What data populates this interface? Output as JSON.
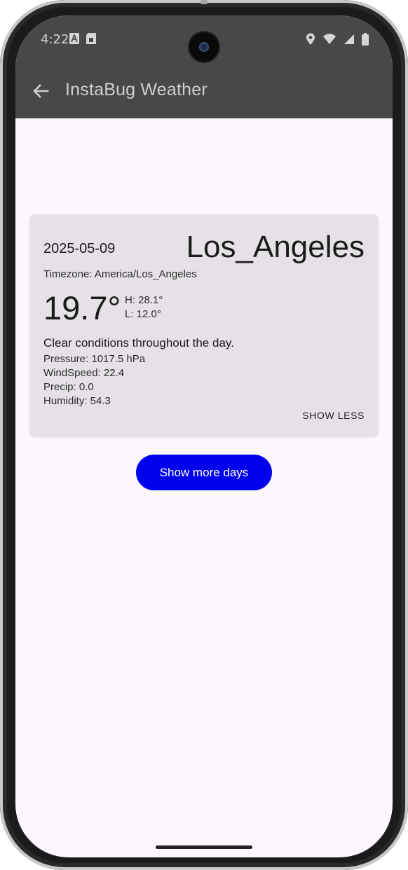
{
  "status_bar": {
    "time": "4:22",
    "icons_left": [
      "a-icon",
      "sim-card-icon"
    ],
    "icons_right": [
      "location-icon",
      "wifi-icon",
      "cellular-signal-icon",
      "battery-icon"
    ]
  },
  "app_bar": {
    "title": "InstaBug Weather",
    "back_icon": "arrow-back-icon"
  },
  "weather_card": {
    "date": "2025-05-09",
    "city": "Los_Angeles",
    "timezone": "Timezone: America/Los_Angeles",
    "temperature": "19.7°",
    "high": "H: 28.1°",
    "low": "L: 12.0°",
    "description": "Clear conditions throughout the day.",
    "pressure": "Pressure: 1017.5 hPa",
    "wind_speed": "WindSpeed: 22.4",
    "precip": "Precip: 0.0",
    "humidity": "Humidity: 54.3",
    "toggle_label": "SHOW LESS"
  },
  "actions": {
    "show_more_days": "Show more days"
  },
  "colors": {
    "primary_button": "#0000ee",
    "card_background": "#e5e1e6",
    "screen_background": "#fcf7fc",
    "app_bar_overlay": "#494849"
  }
}
